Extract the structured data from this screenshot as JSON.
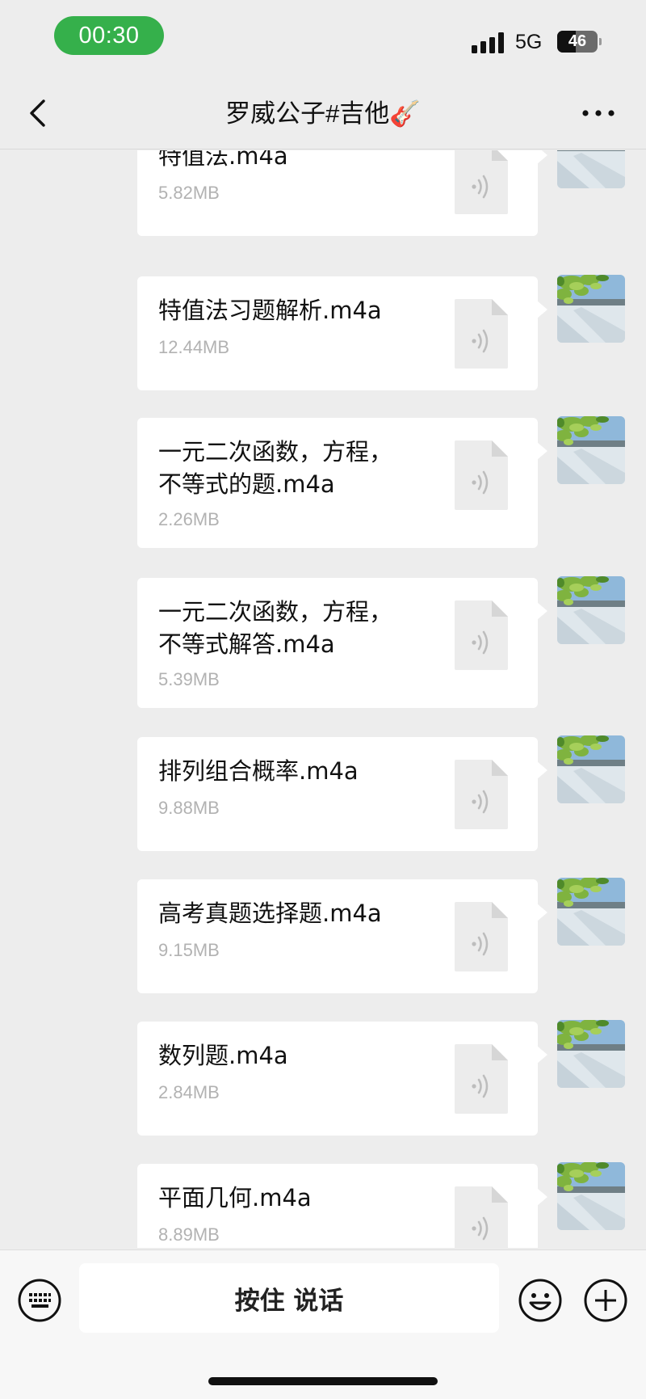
{
  "status_bar": {
    "time": "00:30",
    "network": "5G",
    "battery": "46",
    "battery_percent": 46
  },
  "nav": {
    "title": "罗威公子#吉他🎸"
  },
  "messages": [
    {
      "name": "特值法.m4a",
      "size": "5.82MB"
    },
    {
      "name": "特值法习题解析.m4a",
      "size": "12.44MB"
    },
    {
      "name": "一元二次函数，方程，不等式的题.m4a",
      "size": "2.26MB"
    },
    {
      "name": "一元二次函数，方程，不等式解答.m4a",
      "size": "5.39MB"
    },
    {
      "name": "排列组合概率.m4a",
      "size": "9.88MB"
    },
    {
      "name": "高考真题选择题.m4a",
      "size": "9.15MB"
    },
    {
      "name": "数列题.m4a",
      "size": "2.84MB"
    },
    {
      "name": "平面几何.m4a",
      "size": "8.89MB"
    }
  ],
  "input_bar": {
    "hold_to_talk": "按住 说话"
  },
  "colors": {
    "accent": "#35b04b",
    "background": "#ededed",
    "bubble": "#ffffff",
    "meta_text": "#b2b2b2"
  },
  "icons": [
    "back-icon",
    "more-icon",
    "audio-file-icon",
    "keyboard-icon",
    "emoji-icon",
    "plus-icon"
  ]
}
